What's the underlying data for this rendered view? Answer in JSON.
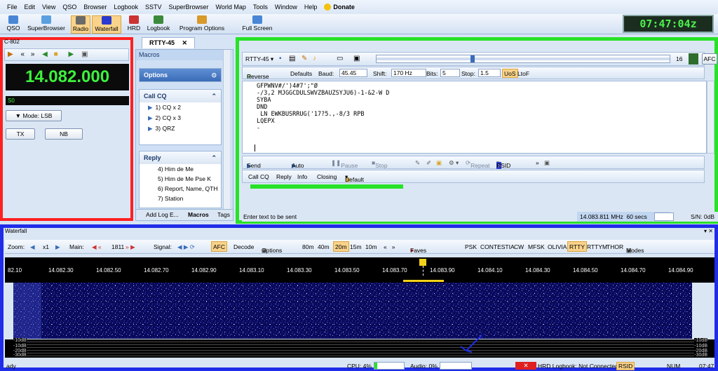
{
  "menu": [
    "File",
    "Edit",
    "View",
    "QSO",
    "Browser",
    "Logbook",
    "SSTV",
    "SuperBrowser",
    "World Map",
    "Tools",
    "Window",
    "Help",
    "Donate"
  ],
  "toolbar": {
    "qso": "QSO",
    "superbrowser": "SuperBrowser",
    "radio": "Radio",
    "waterfall": "Waterfall",
    "hrd": "HRD",
    "logbook": "Logbook",
    "program_options": "Program Options",
    "full_screen": "Full Screen"
  },
  "clock": "07:47:04z",
  "radio": {
    "title": "C-802",
    "frequency": "14.082.000",
    "smeter": "S0",
    "mode": "Mode: LSB",
    "tx": "TX",
    "nb": "NB"
  },
  "macros": {
    "tab": "RTTY-45",
    "header": "Macros",
    "options": "Options",
    "call_cq": "Call CQ",
    "cq_items": [
      "1) CQ x 2",
      "2) CQ x 3",
      "3) QRZ"
    ],
    "reply": "Reply",
    "reply_items": [
      "4) Him de Me",
      "5) Him de Me Pse K",
      "6) Report, Name, QTH",
      "7) Station"
    ],
    "bottom_tabs": [
      "Add Log E...",
      "Macros",
      "Tags"
    ]
  },
  "rtty": {
    "mode": "RTTY-45",
    "reverse": "Reverse",
    "defaults": "Defaults",
    "baud_label": "Baud:",
    "baud": "45.45",
    "shift_label": "Shift:",
    "shift": "170 Hz",
    "bits_label": "Bits:",
    "bits": "5",
    "stop_label": "Stop:",
    "stop": "1.5",
    "uos": "UoS",
    "ltof": "LtoF",
    "afc": "AFC",
    "level": "16",
    "rx_text": "GFPWNV#/')4#7';\"Ø\n-/3,2 MJGGCDULSWVZBAUZSYJU6)-1-&2-W D\nSYBA\nDND\n LN EWKBUSRRUG('17?5.,-8/3 RPB\nLQEPX\n-",
    "send": "Send (F1)",
    "auto": "Auto (F2)",
    "pause": "Pause (F3)",
    "stop_tx": "Stop (F4)",
    "repeat": "Repeat",
    "rsid": "RSID",
    "macro_btns": [
      "Call CQ",
      "Reply",
      "Info",
      "Closing",
      "Default"
    ],
    "tx_placeholder": "Enter text to be sent",
    "status_freq": "14.083.811 MHz",
    "status_secs": "60 secs",
    "sn": "S/N: 0dB"
  },
  "waterfall": {
    "title": "Waterfall",
    "zoom": "Zoom:",
    "x1": "x1",
    "main": "Main:",
    "main_val": "1811",
    "signal": "Signal:",
    "afc": "AFC",
    "decode": "Decode",
    "options": "Options",
    "bands": [
      "80m",
      "40m",
      "20m",
      "15m",
      "10m"
    ],
    "faves": "Faves",
    "modes": [
      "PSK",
      "CONTESTIA",
      "CW",
      "MFSK",
      "OLIVIA",
      "RTTY",
      "RTTYM",
      "THOR"
    ],
    "modes_btn": "Modes",
    "ticks": [
      "82.10",
      "14.082.30",
      "14.082.50",
      "14.082.70",
      "14.082.90",
      "14.083.10",
      "14.083.30",
      "14.083.50",
      "14.083.70",
      "14.083.90",
      "14.084.10",
      "14.084.30",
      "14.084.50",
      "14.084.70",
      "14.084.90"
    ],
    "db_labels": [
      "-10dB",
      "-10dB",
      "-20dB",
      "-30dB"
    ]
  },
  "statusbar": {
    "ready": "ady",
    "cpu": "CPU: 4%",
    "audio": "Audio: 0%",
    "logbook": "HRD Logbook: Not Connected",
    "rsid": "RSID",
    "num": "NUM",
    "time": "07:47"
  },
  "colors": {
    "red_outline": "#ff2020",
    "green_outline": "#27e227",
    "blue_outline": "#1f2de8",
    "freq_green": "#3cf23c"
  }
}
